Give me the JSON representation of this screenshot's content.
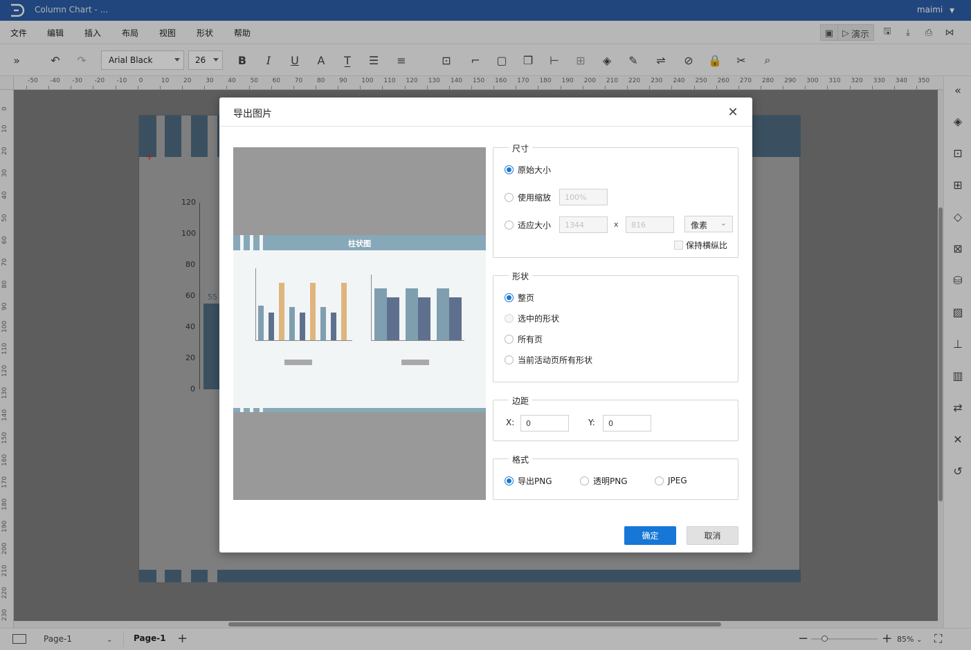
{
  "app": {
    "doc_title": "Column Chart - ...",
    "user": "maimi"
  },
  "menu": [
    "文件",
    "编辑",
    "插入",
    "布局",
    "视图",
    "形状",
    "帮助"
  ],
  "header_tools": {
    "present_label": "演示"
  },
  "toolbar": {
    "font_family": "Arial Black",
    "font_size": "26"
  },
  "ruler": {
    "h_ticks": [
      "-50",
      "-40",
      "-30",
      "-20",
      "-10",
      "0",
      "10",
      "20",
      "30",
      "40",
      "50",
      "60",
      "70",
      "80",
      "90",
      "100",
      "110",
      "120",
      "130",
      "140",
      "150",
      "160",
      "170",
      "180",
      "190",
      "200",
      "210",
      "220",
      "230",
      "240",
      "250",
      "260",
      "270",
      "280",
      "290",
      "300",
      "310",
      "320",
      "330",
      "340",
      "350"
    ],
    "v_ticks": [
      "0",
      "10",
      "20",
      "30",
      "40",
      "50",
      "60",
      "70",
      "80",
      "90",
      "100",
      "110",
      "120",
      "130",
      "140",
      "150",
      "160",
      "170",
      "180",
      "190",
      "200",
      "210",
      "220",
      "230"
    ]
  },
  "canvas_chart": {
    "y_ticks": [
      "120",
      "100",
      "80",
      "60",
      "40",
      "20",
      "0"
    ],
    "value_label": "55"
  },
  "dialog": {
    "title": "导出图片",
    "size_group": {
      "legend": "尺寸",
      "original_label": "原始大小",
      "scale_label": "使用缩放",
      "scale_value": "100%",
      "fit_label": "适应大小",
      "width_value": "1344",
      "x_sep": "x",
      "height_value": "816",
      "unit": "像素",
      "keep_ratio_label": "保持横纵比"
    },
    "shape_group": {
      "legend": "形状",
      "options": [
        "整页",
        "选中的形状",
        "所有页",
        "当前活动页所有形状"
      ]
    },
    "margin_group": {
      "legend": "边距",
      "x_label": "X:",
      "x_value": "0",
      "y_label": "Y:",
      "y_value": "0"
    },
    "format_group": {
      "legend": "格式",
      "options": [
        "导出PNG",
        "透明PNG",
        "JPEG"
      ]
    },
    "ok_label": "确定",
    "cancel_label": "取消",
    "preview": {
      "banner_title": "柱状图"
    }
  },
  "status": {
    "page_select": "Page-1",
    "page_tab": "Page-1",
    "zoom": "85%"
  },
  "colors": {
    "titlebar": "#2c5ea9",
    "accent": "#1677d6",
    "band": "#4e6b80"
  }
}
